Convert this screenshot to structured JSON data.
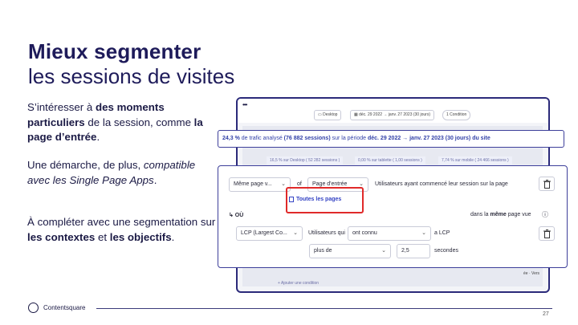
{
  "slide": {
    "title_bold": "Mieux segmenter",
    "title_light": "les sessions de visites",
    "paragraph1": {
      "p1": "S’intéresser à ",
      "b1": "des moments particuliers",
      "p2": " de la session, comme ",
      "b2": "la page d’entrée",
      "p3": "."
    },
    "paragraph2": {
      "p1": "Une démarche, de plus, ",
      "i1": "compatible avec les Single Page Apps",
      "p2": "."
    },
    "paragraph3": {
      "p1": "À compléter avec une segmentation sur ",
      "b1": "les contextes",
      "p2": " et ",
      "b2": "les objectifs",
      "p3": "."
    },
    "logo_text": "Contentsquare",
    "page_number": "27"
  },
  "screenshot": {
    "menu_dots": "•••",
    "device_pill": "Desktop",
    "date_pill": "déc. 29 2022 → janv. 27 2023 (30 jours)",
    "condition_pill": "1 Condition",
    "row2": [
      "16,5 % sur Desktop ( 52 282 sessions )",
      "0,00 % sur tablette ( 1,00 sessions )",
      "7,74 % sur mobile ( 24 466 sessions )"
    ],
    "add_condition": "+ Ajouter une condition",
    "side_label": "ée · Vers"
  },
  "summary_bar": {
    "pct": "24,3 %",
    "text1": " de trafic analysé ",
    "sessions": "(76 882 sessions)",
    "text2": " sur la période ",
    "period": "déc. 29 2022 → janv. 27 2023 (30 jours) du site"
  },
  "panel": {
    "sel1": "Même page v...",
    "of": "of",
    "sel2": "Page d'entrée",
    "sentence": "Utilisateurs ayant commencé leur session sur la page",
    "link": "Toutes les pages",
    "ou": "↳ OÙ",
    "same_page_pre": "dans la ",
    "same_page_bold": "même",
    "same_page_post": " page vue",
    "help_icon": "ⓘ",
    "metric": "LCP (Largest Co...",
    "users_who": "Utilisateurs qui",
    "verb": "ont connu",
    "a_lcp": "a LCP",
    "operator": "plus de",
    "value": "2,5",
    "unit": "secondes",
    "colors": {
      "border": "#3d3f9a",
      "highlight": "#e02a2a",
      "link": "#3342c4"
    }
  }
}
